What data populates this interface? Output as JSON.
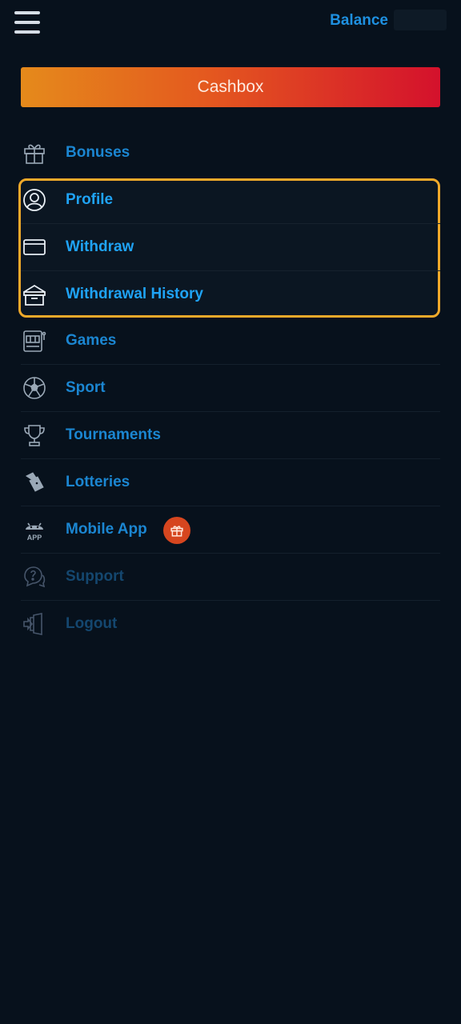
{
  "header": {
    "menu_icon": "hamburger-icon",
    "balance_label": "Balance"
  },
  "cashbox": {
    "label": "Cashbox"
  },
  "colors": {
    "background": "#07111c",
    "accent_blue": "#1b86d1",
    "highlight_border": "#f0a92a",
    "cashbox_gradient_start": "#e58a1b",
    "cashbox_gradient_end": "#d4112c",
    "badge": "#d6461f"
  },
  "menu": {
    "items": [
      {
        "label": "Bonuses",
        "icon": "gift-icon"
      },
      {
        "label": "Profile",
        "icon": "user-circle-icon"
      },
      {
        "label": "Withdraw",
        "icon": "card-icon"
      },
      {
        "label": "Withdrawal History",
        "icon": "archive-box-icon"
      },
      {
        "label": "Games",
        "icon": "slot-machine-icon"
      },
      {
        "label": "Sport",
        "icon": "soccer-ball-icon"
      },
      {
        "label": "Tournaments",
        "icon": "trophy-icon"
      },
      {
        "label": "Lotteries",
        "icon": "lottery-tickets-icon"
      },
      {
        "label": "Mobile App",
        "icon": "android-app-icon",
        "badge_icon": "gift-icon",
        "app_text": "APP"
      },
      {
        "label": "Support",
        "icon": "help-chat-icon"
      },
      {
        "label": "Logout",
        "icon": "logout-icon"
      }
    ]
  }
}
